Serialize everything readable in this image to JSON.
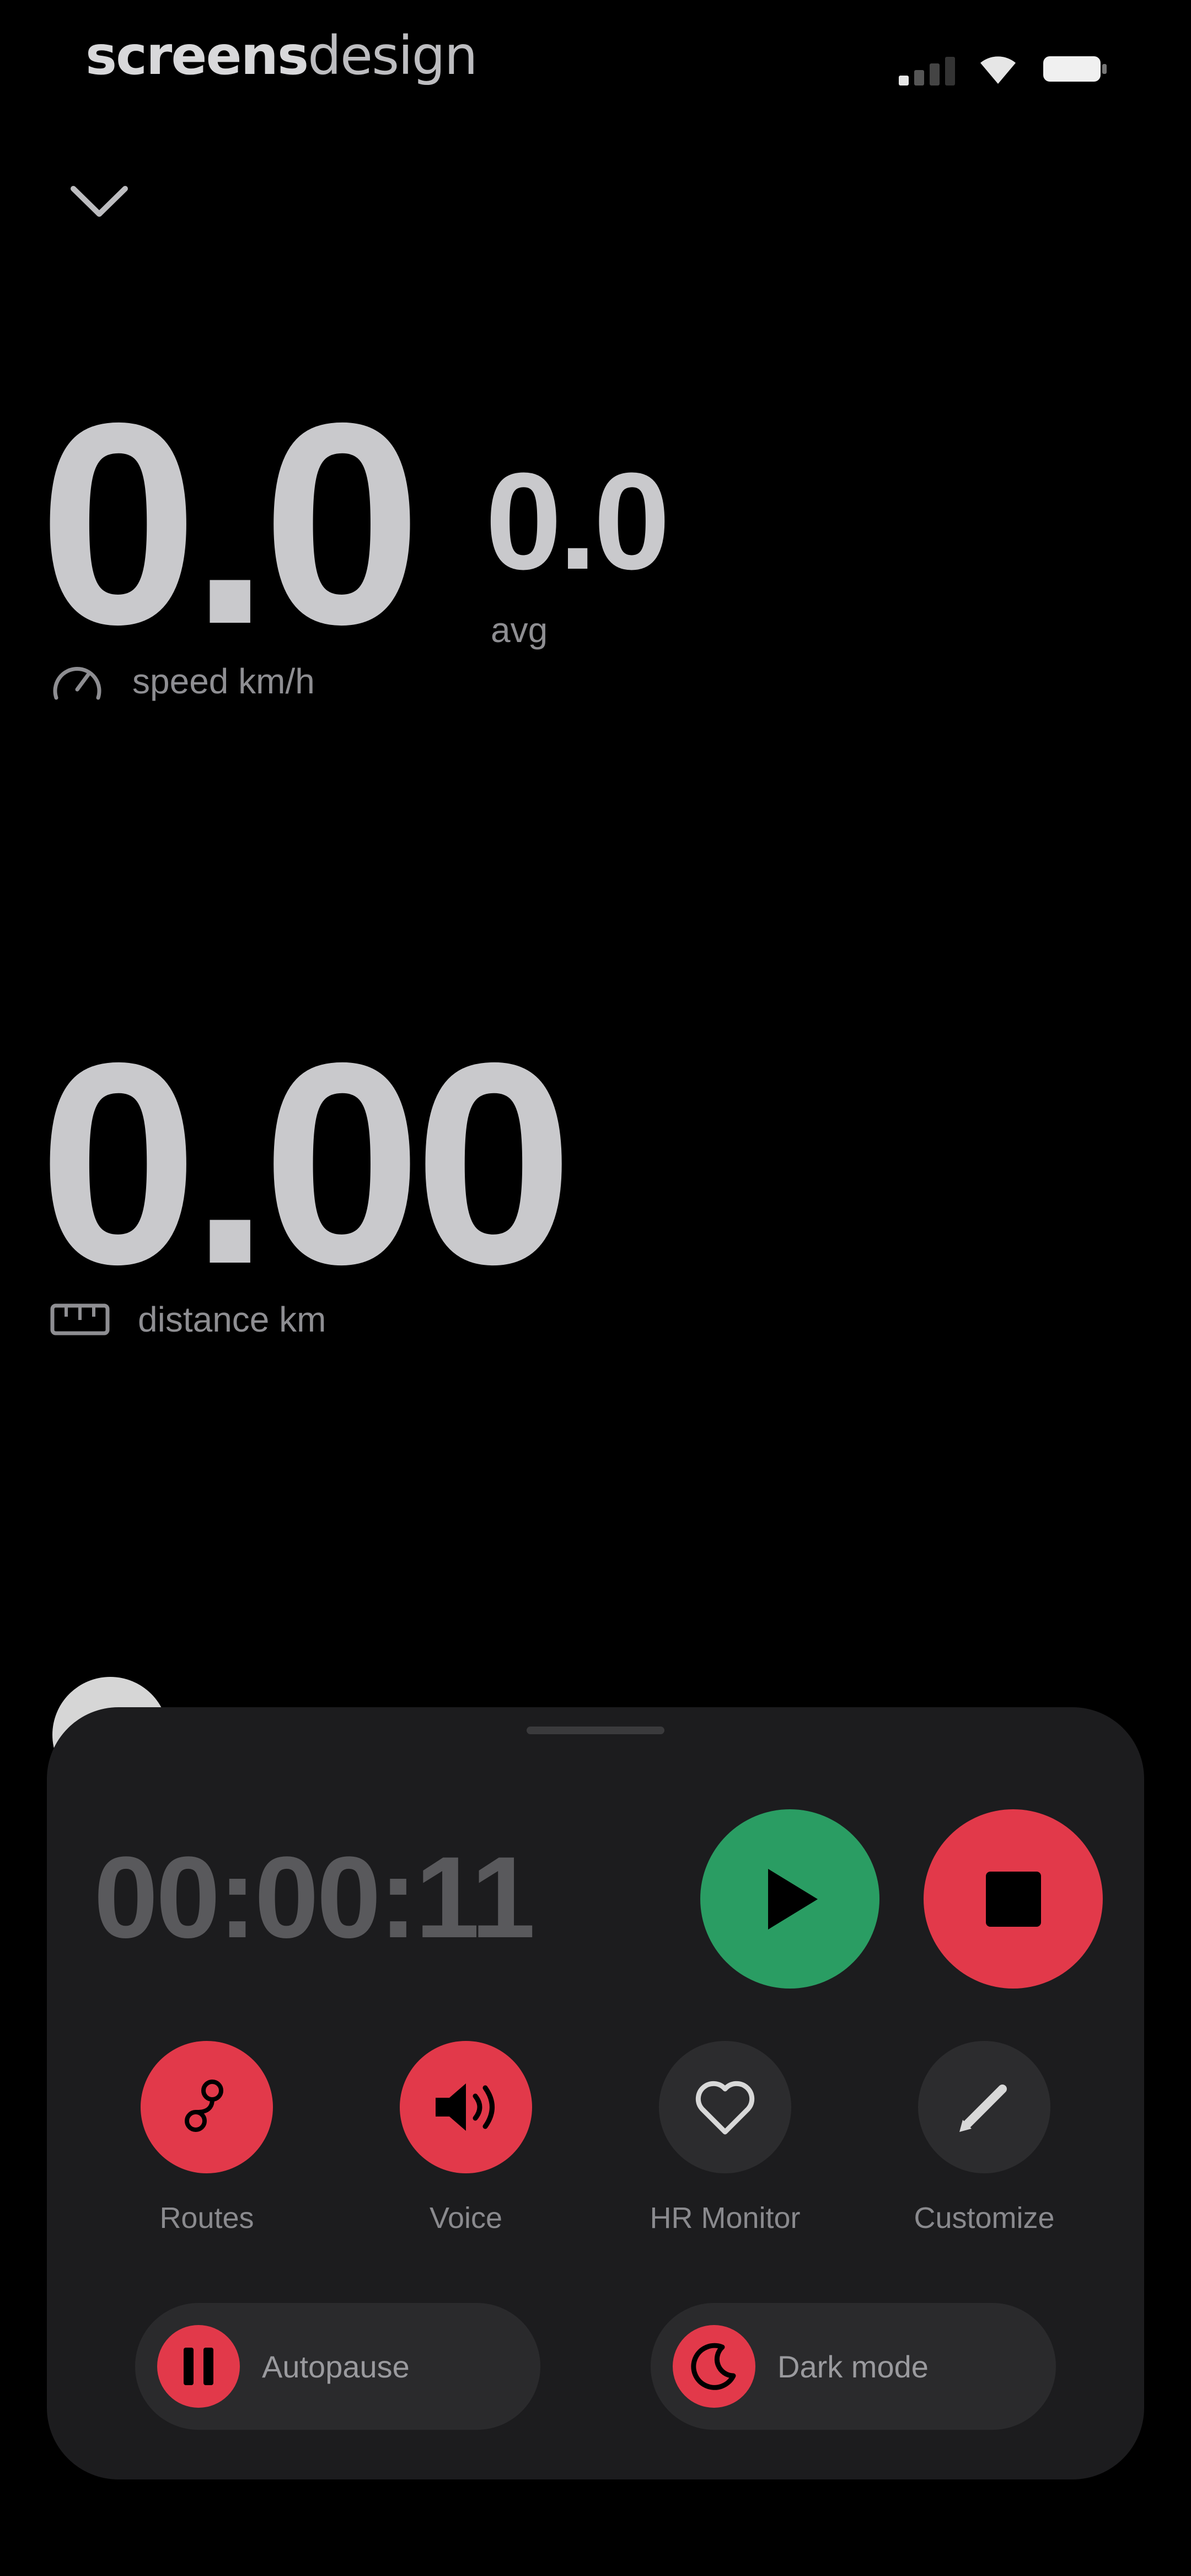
{
  "status_bar": {
    "brand_bold": "screens",
    "brand_light": "design"
  },
  "metrics": {
    "speed_value": "0.0",
    "speed_label": "speed km/h",
    "avg_value": "0.0",
    "avg_label": "avg",
    "distance_value": "0.00",
    "distance_label": "distance km"
  },
  "sheet": {
    "timer": "00:00:11",
    "actions": [
      {
        "label": "Routes",
        "icon": "routes-icon"
      },
      {
        "label": "Voice",
        "icon": "speaker-icon"
      },
      {
        "label": "HR Monitor",
        "icon": "heart-icon"
      },
      {
        "label": "Customize",
        "icon": "pencil-icon"
      }
    ],
    "toggles": [
      {
        "label": "Autopause",
        "icon": "pause-icon"
      },
      {
        "label": "Dark mode",
        "icon": "moon-icon"
      }
    ]
  },
  "colors": {
    "play": "#2a9d63",
    "stop": "#e2394a",
    "accent_red": "#e2394a",
    "sheet_bg": "#1c1c1e"
  }
}
